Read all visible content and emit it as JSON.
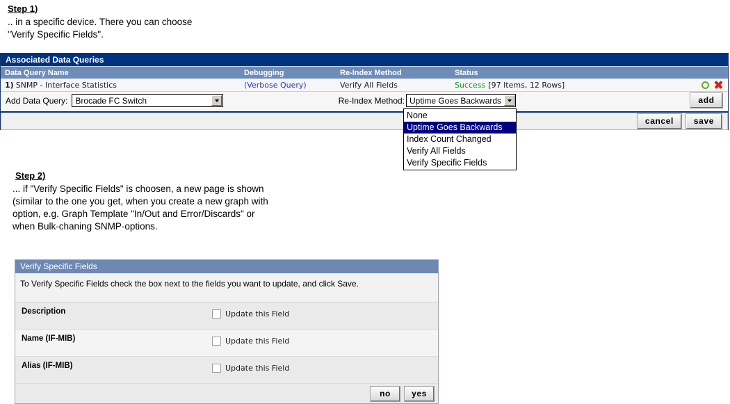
{
  "steps": [
    {
      "title": "Step 1)",
      "body": ".. in a specific device. There you can choose\n\"Verify Specific Fields\"."
    },
    {
      "title": "Step 2)",
      "body": "... if \"Verify Specific Fields\" is choosen, a new page is shown\n(similar to the one you get, when you create a new graph with\n option, e.g. Graph Template \"In/Out and Error/Discards\" or\nwhen Bulk-chaning SNMP-options."
    }
  ],
  "data_queries_panel": {
    "title": "Associated Data Queries",
    "columns": [
      "Data Query Name",
      "Debugging",
      "Re-Index Method",
      "Status"
    ],
    "rows": [
      {
        "index": "1)",
        "name": "SNMP - Interface Statistics",
        "debugging": "(Verbose Query)",
        "reindex_method": "Verify All Fields",
        "status_state": "Success",
        "status_detail": "[97 Items, 12 Rows]",
        "refresh_icon": "refresh-circle-icon",
        "delete_icon": "delete-x-icon"
      }
    ],
    "add_row": {
      "add_label": "Add Data Query:",
      "data_query_value": "Brocade FC Switch",
      "reindex_label": "Re-Index Method:",
      "reindex_value": "Uptime Goes Backwards",
      "add_button": "add"
    },
    "reindex_options": [
      "None",
      "Uptime Goes Backwards",
      "Index Count Changed",
      "Verify All Fields",
      "Verify Specific Fields"
    ],
    "reindex_selected": "Uptime Goes Backwards",
    "action_buttons": [
      "cancel",
      "save"
    ]
  },
  "verify_specific_fields_panel": {
    "title": "Verify Specific Fields",
    "intro": "To Verify Specific Fields check the box next to the fields you want to update, and click Save.",
    "checkbox_label": "Update this Field",
    "fields": [
      {
        "label": "Description",
        "checked": false
      },
      {
        "label": "Name (IF-MIB)",
        "checked": false
      },
      {
        "label": "Alias (IF-MIB)",
        "checked": false
      }
    ],
    "footer_buttons": [
      "no",
      "yes"
    ]
  },
  "colors": {
    "panel_title_bar": "#00337f",
    "column_header": "#6e8cb8",
    "vsf_title_bar": "#6d88b3",
    "status_success": "#0f9c2a",
    "link": "#3030c0",
    "dropdown_selected": "#000080",
    "delete_icon": "#d42418",
    "refresh_icon": "#5fa832"
  }
}
